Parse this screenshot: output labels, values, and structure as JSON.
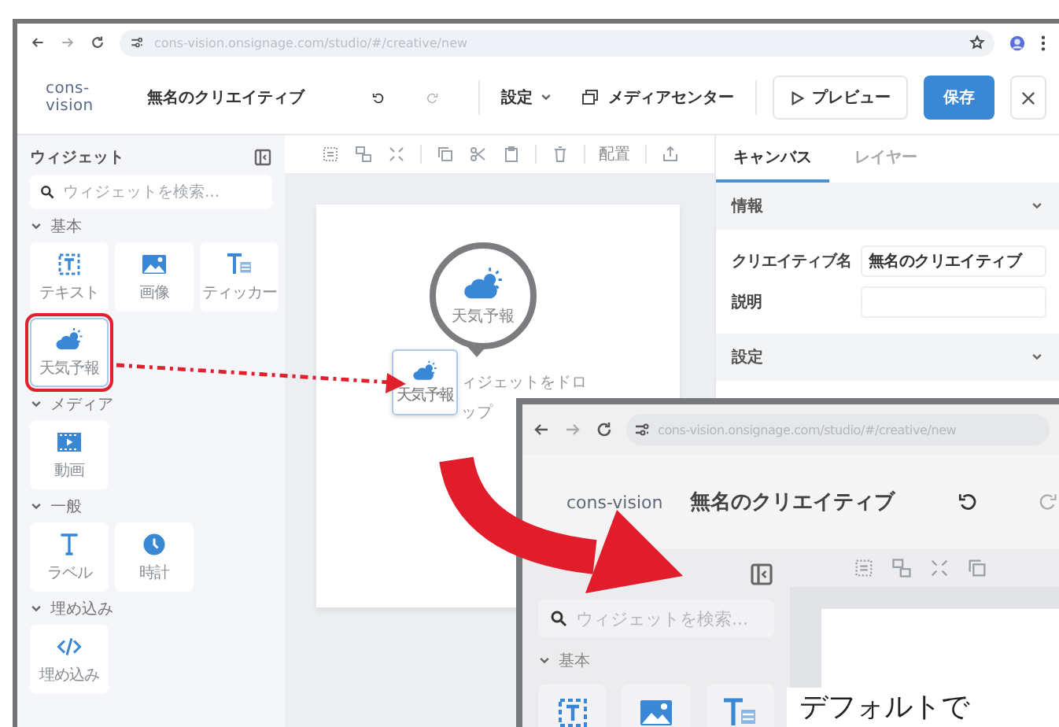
{
  "browser": {
    "url": "cons-vision.onsignage.com/studio/#/creative/new"
  },
  "header": {
    "logo": "cons-vision",
    "title": "無名のクリエイティブ",
    "settings_menu": "設定",
    "media_center": "メディアセンター",
    "preview": "プレビュー",
    "save": "保存"
  },
  "sidebar": {
    "title": "ウィジェット",
    "search_placeholder": "ウィジェットを検索...",
    "groups": [
      {
        "label": "基本",
        "expanded": true,
        "items": [
          {
            "label": "テキスト",
            "kind": "text",
            "selected": false
          },
          {
            "label": "画像",
            "kind": "image",
            "selected": false
          },
          {
            "label": "ティッカー",
            "kind": "ticker",
            "selected": false
          },
          {
            "label": "天気予報",
            "kind": "weather",
            "selected": true
          }
        ]
      },
      {
        "label": "メディア",
        "expanded": true,
        "items": [
          {
            "label": "動画",
            "kind": "video",
            "selected": false
          }
        ]
      },
      {
        "label": "一般",
        "expanded": true,
        "items": [
          {
            "label": "ラベル",
            "kind": "label",
            "selected": false
          },
          {
            "label": "時計",
            "kind": "clock",
            "selected": false
          }
        ]
      },
      {
        "label": "埋め込み",
        "expanded": true,
        "items": [
          {
            "label": "埋め込み",
            "kind": "embed",
            "selected": false
          }
        ]
      }
    ]
  },
  "toolbar": {
    "arrange": "配置"
  },
  "canvas": {
    "drop_hint_lines": [
      "ィジェットをドロ",
      "ップ"
    ],
    "magnifier_label": "天気予報",
    "dragged_widget": "天気予報"
  },
  "panel": {
    "tabs": [
      {
        "label": "キャンバス",
        "selected": true
      },
      {
        "label": "レイヤー",
        "selected": false
      }
    ],
    "sections": [
      {
        "title": "情報",
        "fields": [
          {
            "label": "クリエイティブ名",
            "value": "無名のクリエイティブ"
          },
          {
            "label": "説明"
          }
        ]
      },
      {
        "title": "設定"
      }
    ]
  },
  "overlay_screenshot": {
    "url": "cons-vision.onsignage.com/studio/#/creative/new",
    "logo": "cons-vision",
    "title": "無名のクリエイティブ",
    "search_placeholder": "ウィジェットを検索...",
    "group": "基本",
    "widgets": [
      {
        "kind": "text"
      },
      {
        "kind": "image"
      },
      {
        "kind": "ticker"
      }
    ],
    "caption": "デフォルトで"
  }
}
